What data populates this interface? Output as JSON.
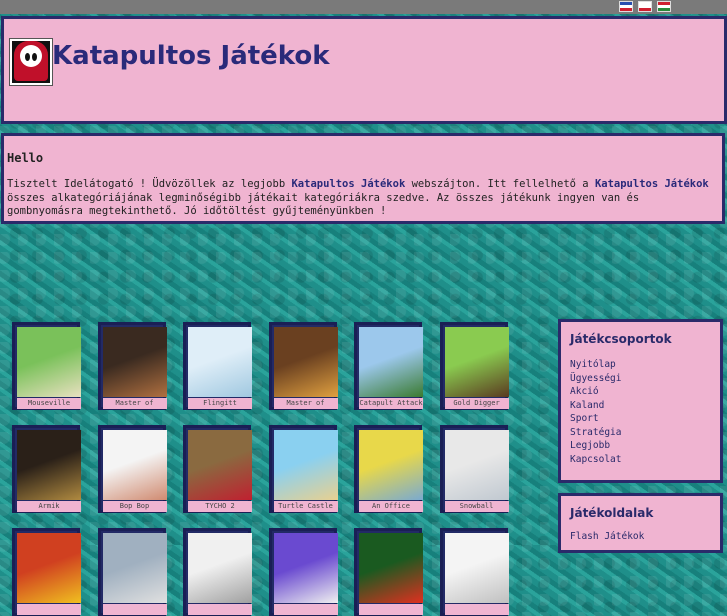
{
  "header": {
    "title": "Katapultos Játékok",
    "flags": [
      {
        "name": "french-flag",
        "colors": [
          "#2a4fb0",
          "#ffffff",
          "#d02030"
        ]
      },
      {
        "name": "polish-flag",
        "colors": [
          "#ffffff",
          "#ffffff",
          "#d02030"
        ]
      },
      {
        "name": "hungarian-flag",
        "colors": [
          "#d02030",
          "#ffffff",
          "#2a8a3a"
        ]
      }
    ]
  },
  "welcome": {
    "heading": "Hello",
    "p1": "Tisztelt Idelátogató ! Üdvözöllek az legjobb ",
    "brand1": "Katapultos Játékok",
    "p2": " webszájton. Itt fellelhető a ",
    "brand2": "Katapultos Játékok",
    "p3": " összes alkategóriájának legminőségibb játékait kategóriákra szedve. Az összes játékunk ingyen van és gombnyomásra megtekinthető. Jó időtöltést gyűjteményünkben !"
  },
  "games": [
    {
      "caption": "Mouseville",
      "colors": [
        "#7ac15a",
        "#e8e0c0"
      ]
    },
    {
      "caption": "Master of",
      "colors": [
        "#3a2a20",
        "#b07040"
      ]
    },
    {
      "caption": "Flingitt",
      "colors": [
        "#dfeef8",
        "#a0c8e0"
      ]
    },
    {
      "caption": "Master of",
      "colors": [
        "#6a4020",
        "#e0a040"
      ]
    },
    {
      "caption": "Catapult Attack",
      "colors": [
        "#9cc8ec",
        "#3a7a30"
      ]
    },
    {
      "caption": "Gold Digger",
      "colors": [
        "#8acb50",
        "#5a3a20"
      ]
    },
    {
      "caption": "Armik",
      "colors": [
        "#2a2018",
        "#b08a40"
      ]
    },
    {
      "caption": "Bop Bop",
      "colors": [
        "#f4f4f4",
        "#d08a70"
      ]
    },
    {
      "caption": "TYCHO 2",
      "colors": [
        "#8a6a40",
        "#c02030"
      ]
    },
    {
      "caption": "Turtle Castle",
      "colors": [
        "#8ad0f0",
        "#e8d090"
      ]
    },
    {
      "caption": "An Office",
      "colors": [
        "#e8d84a",
        "#7aaad0"
      ]
    },
    {
      "caption": "Snowball",
      "colors": [
        "#e8e8e8",
        "#c0c8d0"
      ]
    },
    {
      "caption": "",
      "colors": [
        "#d04020",
        "#f0c020"
      ]
    },
    {
      "caption": "",
      "colors": [
        "#a0b0c0",
        "#e0e0e0"
      ]
    },
    {
      "caption": "",
      "colors": [
        "#f0f0f0",
        "#a0a0a0"
      ]
    },
    {
      "caption": "",
      "colors": [
        "#6a4ad0",
        "#f0f0f0"
      ]
    },
    {
      "caption": "",
      "colors": [
        "#1a5a20",
        "#e03020"
      ]
    },
    {
      "caption": "",
      "colors": [
        "#f4f4f4",
        "#c0c0c0"
      ]
    }
  ],
  "sidebar": {
    "groups_title": "Játékcsoportok",
    "groups": [
      "Nyitólap",
      "Ügyességi",
      "Akció",
      "Kaland",
      "Sport",
      "Stratégia",
      "Legjobb",
      "Kapcsolat"
    ],
    "pages_title": "Játékoldalak",
    "pages": [
      "Flash Játékok"
    ]
  }
}
